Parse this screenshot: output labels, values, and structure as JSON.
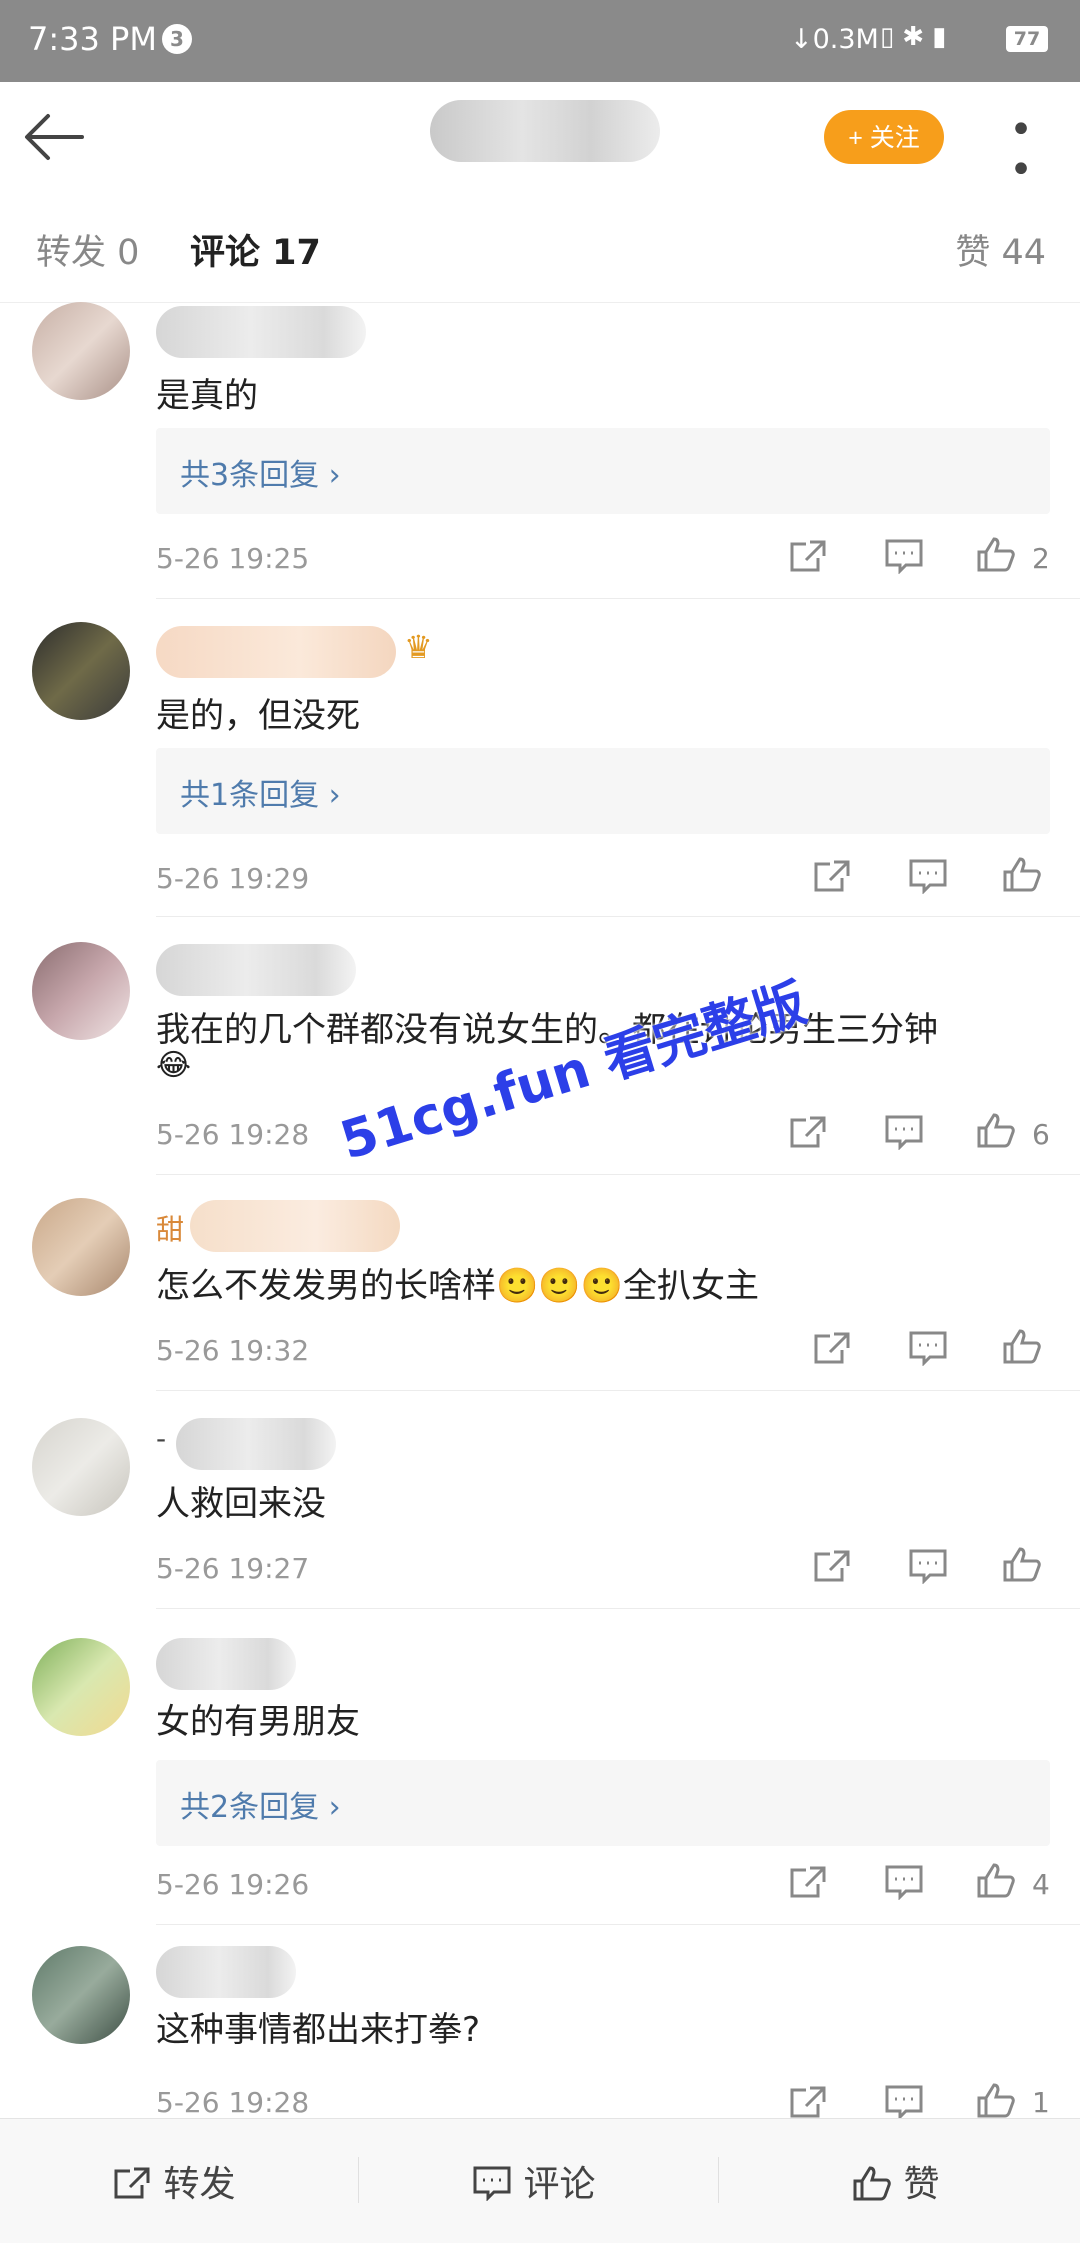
{
  "status_bar": {
    "time": "7:33 PM",
    "notif_count": "3",
    "net_speed": "↓0.3M",
    "battery": "77"
  },
  "nav": {
    "follow_label": "+ 关注",
    "more_glyph": "• • •"
  },
  "tabs": {
    "repost": "转发 0",
    "comments": "评论 17",
    "likes": "赞 44"
  },
  "comments": [
    {
      "text": "是真的",
      "replies": "共3条回复 ›",
      "time": "5-26 19:25",
      "likes": "2"
    },
    {
      "text": "是的，但没死",
      "replies": "共1条回复 ›",
      "time": "5-26 19:29",
      "likes": ""
    },
    {
      "text": "我在的几个群都没有说女生的。都在讨论男生三分钟",
      "emoji": "😂",
      "time": "5-26 19:28",
      "likes": "6"
    },
    {
      "name_prefix": "甜",
      "text": "怎么不发发男的长啥样🙂🙂🙂全扒女主",
      "time": "5-26 19:32",
      "likes": ""
    },
    {
      "name_prefix": "-",
      "text": "人救回来没",
      "time": "5-26 19:27",
      "likes": ""
    },
    {
      "text": "女的有男朋友",
      "replies": "共2条回复 ›",
      "time": "5-26 19:26",
      "likes": "4"
    },
    {
      "text": "这种事情都出来打拳?",
      "time": "5-26 19:28",
      "likes": "1"
    }
  ],
  "watermark": "51cg.fun 看完整版",
  "bottom_bar": {
    "repost": "转发",
    "comment": "评论",
    "like": "赞"
  },
  "colors": {
    "accent": "#f79e1b",
    "link": "#4f7bac",
    "watermark": "#2c3fe8"
  }
}
